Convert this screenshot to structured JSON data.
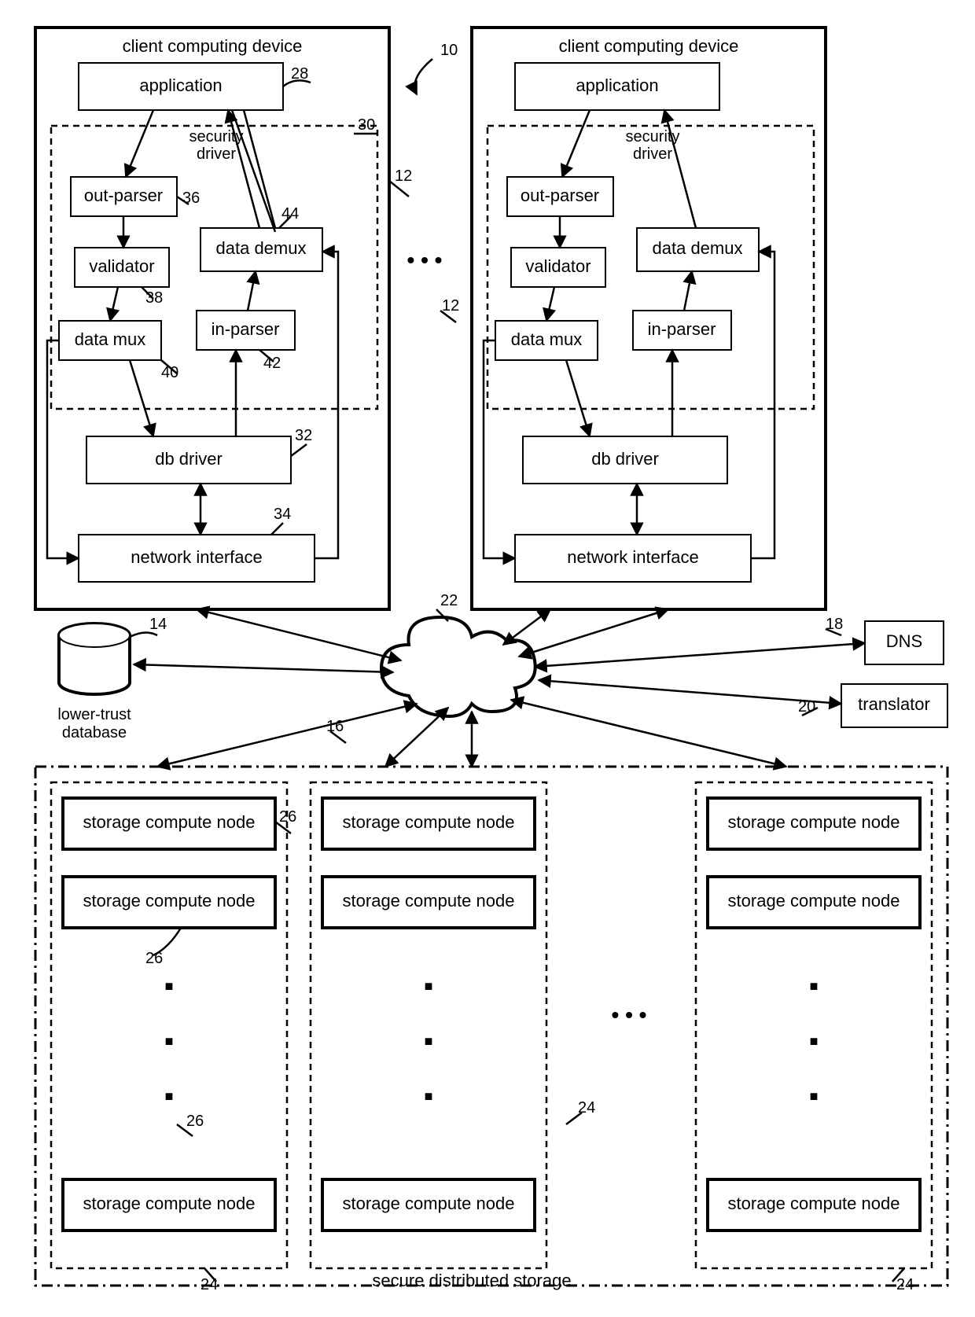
{
  "diagram": {
    "client": {
      "title": "client computing device",
      "application": "application",
      "security_driver_label": "security\ndriver",
      "out_parser": "out-parser",
      "validator": "validator",
      "data_mux": "data mux",
      "data_demux": "data demux",
      "in_parser": "in-parser",
      "db_driver": "db driver",
      "network_interface": "network interface"
    },
    "middle": {
      "lower_trust_db": "lower-trust\ndatabase",
      "dns": "DNS",
      "translator": "translator"
    },
    "storage": {
      "node": "storage compute node",
      "footer": "secure distributed storage"
    },
    "refs": {
      "r10": "10",
      "r12": "12",
      "r14": "14",
      "r16": "16",
      "r18": "18",
      "r20": "20",
      "r22": "22",
      "r24": "24",
      "r26": "26",
      "r28": "28",
      "r30": "30",
      "r32": "32",
      "r34": "34",
      "r36": "36",
      "r38": "38",
      "r40": "40",
      "r42": "42",
      "r44": "44"
    }
  }
}
